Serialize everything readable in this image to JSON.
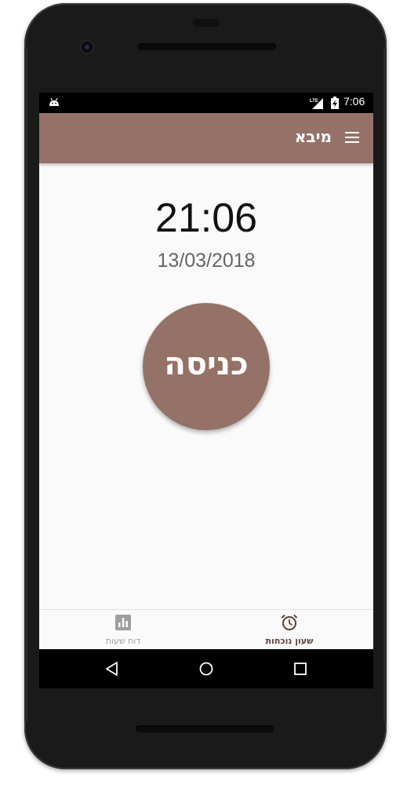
{
  "status_bar": {
    "time": "7:06",
    "network": "LTE",
    "icons": [
      "android-icon",
      "lte-signal-icon",
      "battery-charging-icon"
    ]
  },
  "app_bar": {
    "title": "מיבא",
    "menu_icon": "hamburger-menu-icon",
    "background": "#957268"
  },
  "clock": {
    "time": "21:06",
    "date": "13/03/2018"
  },
  "entry_button": {
    "label": "כניסה",
    "color": "#957268"
  },
  "bottom_nav": {
    "items": [
      {
        "label": "דוח שעות",
        "icon": "bar-chart-icon",
        "active": false
      },
      {
        "label": "שעון נוכחות",
        "icon": "alarm-clock-icon",
        "active": true
      }
    ]
  },
  "system_nav": {
    "icons": [
      "back-icon",
      "home-icon",
      "recent-apps-icon"
    ]
  }
}
